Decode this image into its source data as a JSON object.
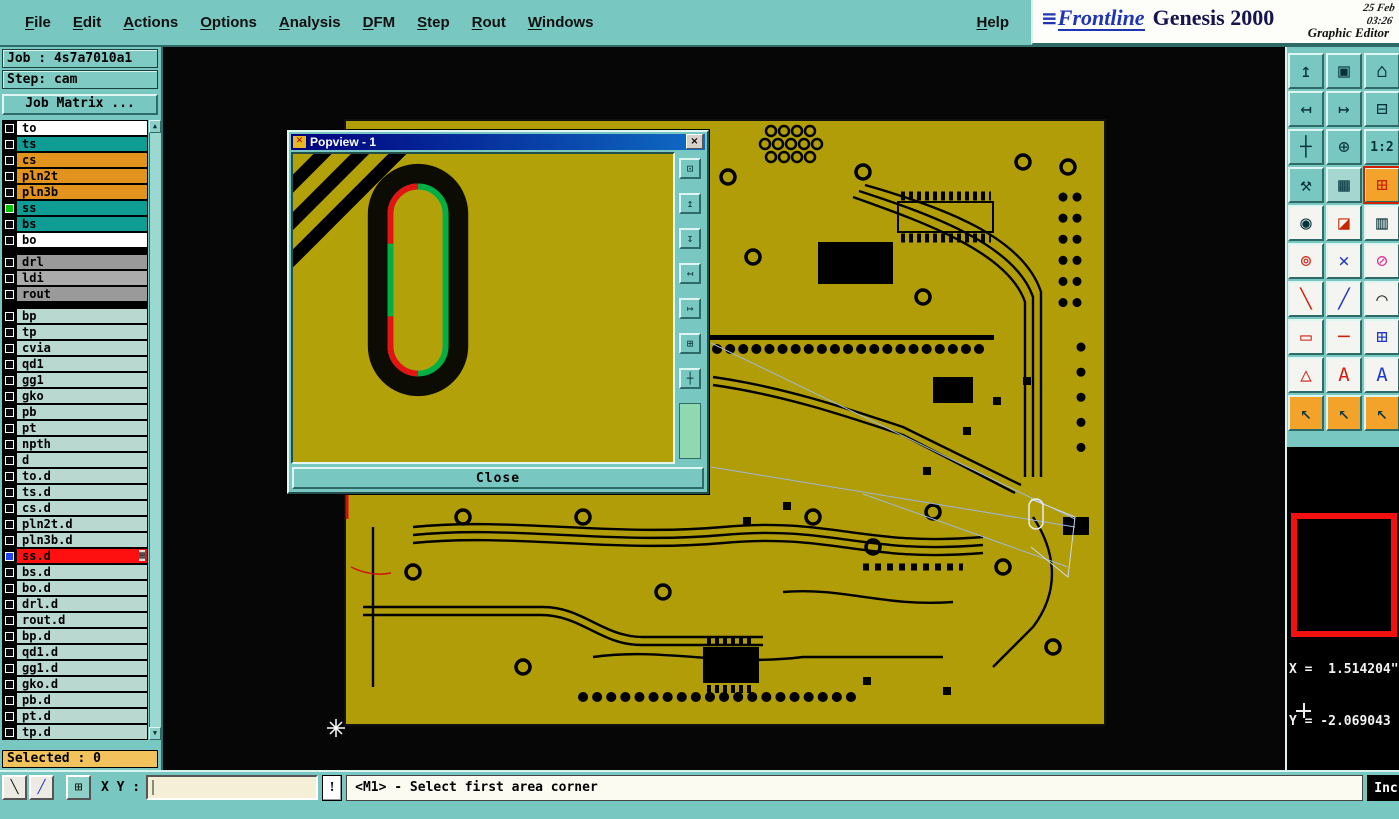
{
  "menubar": {
    "items": [
      "File",
      "Edit",
      "Actions",
      "Options",
      "Analysis",
      "DFM",
      "Step",
      "Rout",
      "Windows"
    ],
    "help": "Help"
  },
  "brand": {
    "logo_prefix": "≡",
    "logo": "Frontline",
    "product": "Genesis 2000",
    "date": "25 Feb",
    "time": "03:26",
    "subtitle": "Graphic Editor"
  },
  "sidebar": {
    "job": "Job : 4s7a7010a1",
    "step": "Step: cam",
    "matrix_button": "Job Matrix ...",
    "selected": "Selected : 0",
    "scroll_up": "▲",
    "scroll_down": "▼",
    "layers": [
      {
        "name": "to",
        "bg": "#ffffff"
      },
      {
        "name": "ts",
        "bg": "#0e9c94"
      },
      {
        "name": "cs",
        "bg": "#e2931d"
      },
      {
        "name": "pln2t",
        "bg": "#e2931d"
      },
      {
        "name": "pln3b",
        "bg": "#e2931d"
      },
      {
        "name": "ss",
        "bg": "#0e9c94",
        "marker": "#00c400"
      },
      {
        "name": "bs",
        "bg": "#0e9c94"
      },
      {
        "name": "bo",
        "bg": "#ffffff"
      },
      {
        "gap": true
      },
      {
        "name": "drl",
        "bg": "#9a9a9a"
      },
      {
        "name": "ldi",
        "bg": "#ababab"
      },
      {
        "name": "rout",
        "bg": "#9a9a9a"
      },
      {
        "gap": true
      },
      {
        "name": "bp",
        "bg": "#b9d8d0"
      },
      {
        "name": "tp",
        "bg": "#b9d8d0"
      },
      {
        "name": "cvia",
        "bg": "#b9d8d0"
      },
      {
        "name": "qd1",
        "bg": "#b9d8d0"
      },
      {
        "name": "gg1",
        "bg": "#b9d8d0"
      },
      {
        "name": "gko",
        "bg": "#b9d8d0"
      },
      {
        "name": "pb",
        "bg": "#b9d8d0"
      },
      {
        "name": "pt",
        "bg": "#b9d8d0"
      },
      {
        "name": "npth",
        "bg": "#b9d8d0"
      },
      {
        "name": "d",
        "bg": "#b9d8d0"
      },
      {
        "name": "to.d",
        "bg": "#b9d8d0"
      },
      {
        "name": "ts.d",
        "bg": "#b9d8d0"
      },
      {
        "name": "cs.d",
        "bg": "#b9d8d0"
      },
      {
        "name": "pln2t.d",
        "bg": "#b9d8d0"
      },
      {
        "name": "pln3b.d",
        "bg": "#b9d8d0"
      },
      {
        "name": "ss.d",
        "bg": "#ff1010",
        "marker": "#2244ee",
        "icon": "▦"
      },
      {
        "name": "bs.d",
        "bg": "#b9d8d0"
      },
      {
        "name": "bo.d",
        "bg": "#b9d8d0"
      },
      {
        "name": "drl.d",
        "bg": "#b9d8d0"
      },
      {
        "name": "rout.d",
        "bg": "#b9d8d0"
      },
      {
        "name": "bp.d",
        "bg": "#b9d8d0"
      },
      {
        "name": "qd1.d",
        "bg": "#b9d8d0"
      },
      {
        "name": "gg1.d",
        "bg": "#b9d8d0"
      },
      {
        "name": "gko.d",
        "bg": "#b9d8d0"
      },
      {
        "name": "pb.d",
        "bg": "#b9d8d0"
      },
      {
        "name": "pt.d",
        "bg": "#b9d8d0"
      },
      {
        "name": "tp.d",
        "bg": "#b9d8d0"
      }
    ]
  },
  "popview": {
    "title": "Popview - 1",
    "icon_glyph": "✕",
    "close_glyph": "×",
    "close": "Close",
    "tools": [
      {
        "name": "popview-zoom-window-icon",
        "glyph": "⊡"
      },
      {
        "name": "popview-zoom-in-icon",
        "glyph": "↥"
      },
      {
        "name": "popview-zoom-out-icon",
        "glyph": "↧"
      },
      {
        "name": "popview-pan-left-icon",
        "glyph": "↤"
      },
      {
        "name": "popview-pan-right-icon",
        "glyph": "↦"
      },
      {
        "name": "popview-fit-icon",
        "glyph": "⊞"
      },
      {
        "name": "popview-center-icon",
        "glyph": "┼"
      }
    ]
  },
  "right_toolbar": {
    "buttons": [
      {
        "name": "restore-view-icon",
        "glyph": "↥"
      },
      {
        "name": "screen-home-icon",
        "glyph": "▣"
      },
      {
        "name": "home-icon",
        "glyph": "⌂"
      },
      {
        "name": "pan-left-icon",
        "glyph": "↤"
      },
      {
        "name": "pan-right-icon",
        "glyph": "↦"
      },
      {
        "name": "windows-cascade-icon",
        "glyph": "⊟"
      },
      {
        "name": "pan-icon",
        "glyph": "┼"
      },
      {
        "name": "zoom-center-icon",
        "glyph": "⊕"
      },
      {
        "name": "zoom-ratio-button",
        "glyph": "1:2",
        "small": true
      },
      {
        "name": "tools-icon",
        "glyph": "⚒"
      },
      {
        "name": "grid-icon",
        "glyph": "▦",
        "bg": "#a5d6cf"
      },
      {
        "name": "active-tool-icon",
        "glyph": "⊞",
        "fg": "#cc2200",
        "bg": "#f4a32a",
        "highlight": true
      },
      {
        "name": "pad-icon",
        "glyph": "◉",
        "bg": "#f4f4f0"
      },
      {
        "name": "layers-fill-icon",
        "glyph": "◪",
        "fg": "#c42700",
        "bg": "#f4f4f0"
      },
      {
        "name": "ruler-icon",
        "glyph": "▥",
        "bg": "#f4f4f0"
      },
      {
        "name": "round-pads-icon",
        "glyph": "⊚",
        "fg": "#d03020",
        "bg": "#f4f4f0"
      },
      {
        "name": "delete-icon",
        "glyph": "×",
        "fg": "#2038c8",
        "bg": "#f4f4f0"
      },
      {
        "name": "erase-icon",
        "glyph": "⊘",
        "fg": "#e0309a",
        "bg": "#f4f4f0"
      },
      {
        "name": "red-line-icon",
        "glyph": "╲",
        "fg": "#d02010",
        "bg": "#f4f4f0"
      },
      {
        "name": "blue-line-icon",
        "glyph": "╱",
        "fg": "#2038c8",
        "bg": "#f4f4f0"
      },
      {
        "name": "arc-icon",
        "glyph": "⌒",
        "fg": "#303030",
        "bg": "#f4f4f0"
      },
      {
        "name": "rect-icon",
        "glyph": "▭",
        "fg": "#d02010",
        "bg": "#f4f4f0"
      },
      {
        "name": "line-icon",
        "glyph": "─",
        "fg": "#d02010",
        "bg": "#f4f4f0"
      },
      {
        "name": "resize-icon",
        "glyph": "⊞",
        "fg": "#2038c8",
        "bg": "#f4f4f0"
      },
      {
        "name": "polygon-icon",
        "glyph": "△",
        "fg": "#d02010",
        "bg": "#f4f4f0"
      },
      {
        "name": "text-icon",
        "glyph": "A",
        "fg": "#d02010",
        "bg": "#f4f4f0"
      },
      {
        "name": "text-alt-icon",
        "glyph": "A",
        "fg": "#2038c8",
        "bg": "#f4f4f0"
      },
      {
        "name": "select-cursor-icon",
        "glyph": "↖",
        "bg": "#f4a32a"
      },
      {
        "name": "select-add-cursor-icon",
        "glyph": "↖",
        "bg": "#f4a32a"
      },
      {
        "name": "select-area-cursor-icon",
        "glyph": "↖",
        "bg": "#f4a32a"
      }
    ]
  },
  "preview": {
    "x_coord": "X =  1.514204\"",
    "y_coord": "Y = -2.069043"
  },
  "statusbar": {
    "buttons": [
      {
        "name": "diagonal-line-icon",
        "glyph": "╲"
      },
      {
        "name": "draw-line-icon",
        "glyph": "╱",
        "fg": "#2038c8"
      },
      {
        "name": "overlay-window-icon",
        "glyph": "⊞",
        "bg": "#8fd0c9"
      }
    ],
    "xy_label": "X Y :",
    "xy_value": "",
    "alert": "!",
    "message": "<M1> - Select first area corner",
    "inc": "Inc"
  }
}
